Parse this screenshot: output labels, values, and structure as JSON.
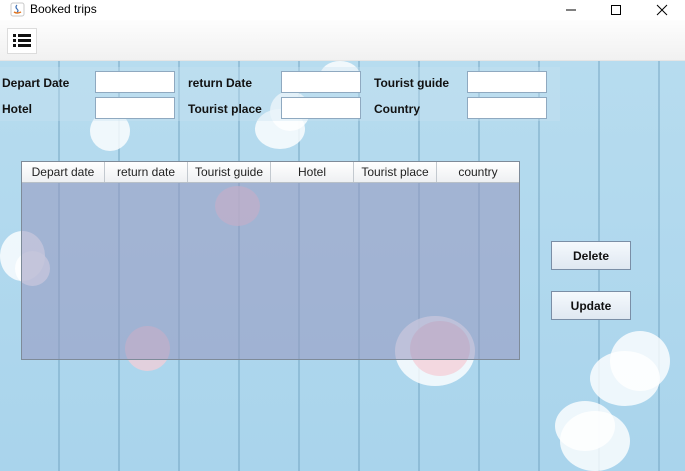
{
  "window": {
    "title": "Booked trips",
    "app_icon": "java-icon",
    "controls": {
      "minimize": "minimize-icon",
      "maximize": "maximize-icon",
      "close": "close-icon"
    }
  },
  "toolbar": {
    "menu_icon": "list-icon"
  },
  "form": {
    "depart_date_label": "Depart Date",
    "return_date_label": "return Date",
    "tourist_guide_label": "Tourist guide",
    "hotel_label": "Hotel",
    "tourist_place_label": "Tourist place",
    "country_label": "Country",
    "depart_date_value": "",
    "return_date_value": "",
    "tourist_guide_value": "",
    "hotel_value": "",
    "tourist_place_value": "",
    "country_value": ""
  },
  "table": {
    "columns": [
      "Depart date",
      "return date",
      "Tourist guide",
      "Hotel",
      "Tourist place",
      "country"
    ],
    "rows": []
  },
  "actions": {
    "delete_label": "Delete",
    "update_label": "Update"
  },
  "colors": {
    "background": "#a9d4ec",
    "table_fill": "#9696be",
    "button_border": "#7a8ea6"
  }
}
